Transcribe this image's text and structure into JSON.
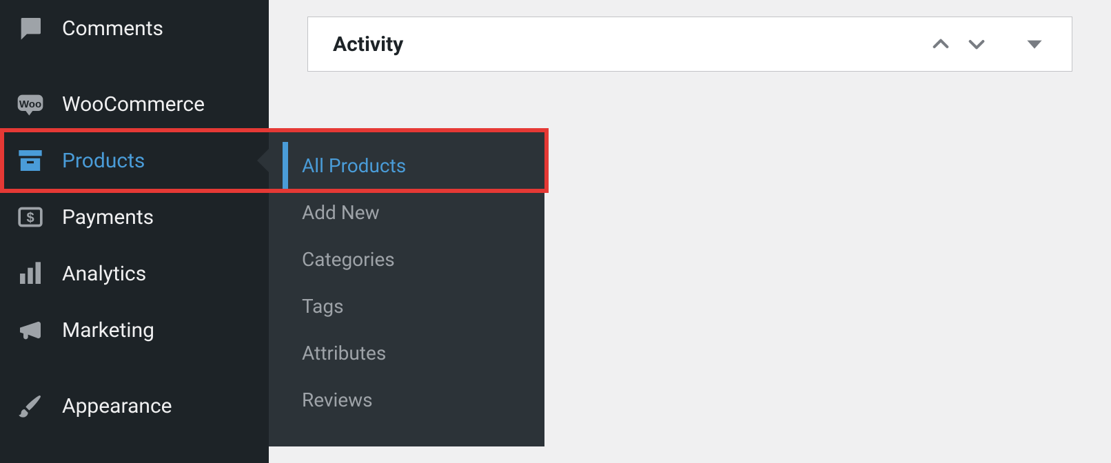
{
  "sidebar": {
    "items": [
      {
        "label": "Comments",
        "icon": "comment-icon"
      },
      {
        "label": "WooCommerce",
        "icon": "woo-icon"
      },
      {
        "label": "Products",
        "icon": "archive-icon",
        "current": true
      },
      {
        "label": "Payments",
        "icon": "dollar-icon"
      },
      {
        "label": "Analytics",
        "icon": "bar-chart-icon"
      },
      {
        "label": "Marketing",
        "icon": "megaphone-icon"
      },
      {
        "label": "Appearance",
        "icon": "brush-icon"
      }
    ]
  },
  "submenu": {
    "parent": "Products",
    "items": [
      {
        "label": "All Products",
        "active": true
      },
      {
        "label": "Add New"
      },
      {
        "label": "Categories"
      },
      {
        "label": "Tags"
      },
      {
        "label": "Attributes"
      },
      {
        "label": "Reviews"
      }
    ]
  },
  "panel": {
    "title": "Activity"
  },
  "colors": {
    "sidebar_bg": "#1d2327",
    "submenu_bg": "#2c3338",
    "accent": "#4a9cd8",
    "highlight_border": "#e53935"
  },
  "annotation": {
    "highlighted_items": [
      "Products",
      "All Products"
    ]
  }
}
